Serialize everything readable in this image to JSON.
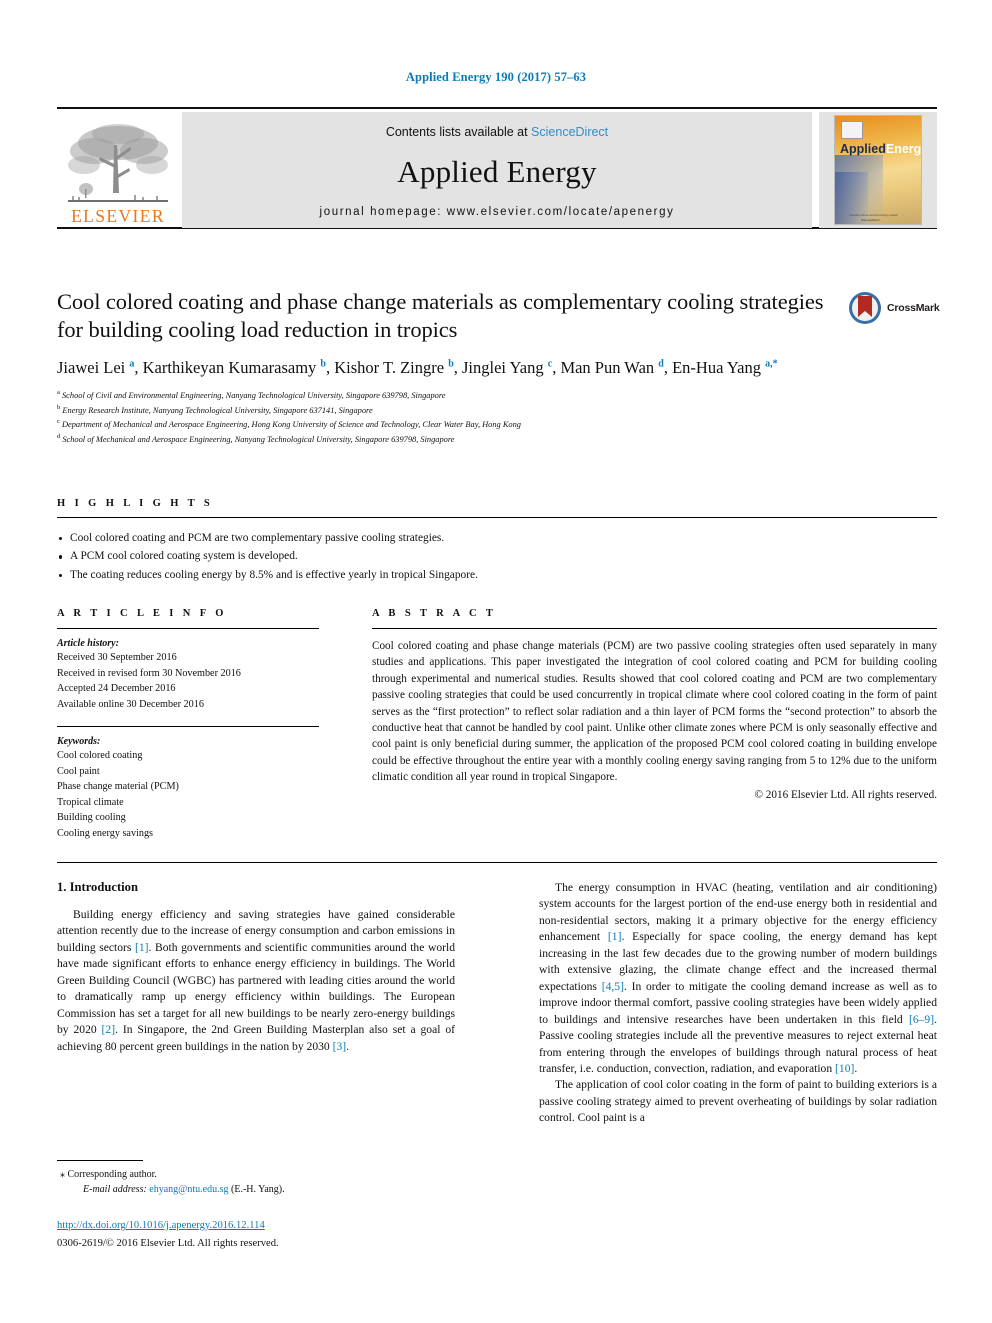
{
  "journal_ref": "Applied Energy 190 (2017) 57–63",
  "masthead": {
    "contents_prefix": "Contents lists available at ",
    "sciencedirect": "ScienceDirect",
    "journal_title": "Applied Energy",
    "homepage": "journal homepage: www.elsevier.com/locate/apenergy",
    "publisher_logo_word": "ELSEVIER",
    "cover": {
      "title_left": "Applied",
      "title_right": "Energy",
      "footer_small": "Constant-volume and time-varying models",
      "footer_small2": "ScienceDirect"
    }
  },
  "title": "Cool colored coating and phase change materials as complementary cooling strategies for building cooling load reduction in tropics",
  "crossmark_label": "CrossMark",
  "authors_html": "Jiawei Lei <sup>a</sup>, Karthikeyan Kumarasamy <sup>b</sup>, Kishor T. Zingre <sup>b</sup>, Jinglei Yang <sup>c</sup>, Man Pun Wan <sup>d</sup>, En-Hua Yang <sup>a,</sup><sup>*</sup>",
  "affiliations": [
    {
      "mark": "a",
      "text": "School of Civil and Environmental Engineering, Nanyang Technological University, Singapore 639798, Singapore"
    },
    {
      "mark": "b",
      "text": "Energy Research Institute, Nanyang Technological University, Singapore 637141, Singapore"
    },
    {
      "mark": "c",
      "text": "Department of Mechanical and Aerospace Engineering, Hong Kong University of Science and Technology, Clear Water Bay, Hong Kong"
    },
    {
      "mark": "d",
      "text": "School of Mechanical and Aerospace Engineering, Nanyang Technological University, Singapore 639798, Singapore"
    }
  ],
  "highlights": {
    "label": "H I G H L I G H T S",
    "items": [
      "Cool colored coating and PCM are two complementary passive cooling strategies.",
      "A PCM cool colored coating system is developed.",
      "The coating reduces cooling energy by 8.5% and is effective yearly in tropical Singapore."
    ]
  },
  "article_info": {
    "label": "A R T I C L E   I N F O",
    "history_label": "Article history:",
    "history": [
      "Received 30 September 2016",
      "Received in revised form 30 November 2016",
      "Accepted 24 December 2016",
      "Available online 30 December 2016"
    ],
    "keywords_label": "Keywords:",
    "keywords": [
      "Cool colored coating",
      "Cool paint",
      "Phase change material (PCM)",
      "Tropical climate",
      "Building cooling",
      "Cooling energy savings"
    ]
  },
  "abstract": {
    "label": "A B S T R A C T",
    "text": "Cool colored coating and phase change materials (PCM) are two passive cooling strategies often used separately in many studies and applications. This paper investigated the integration of cool colored coating and PCM for building cooling through experimental and numerical studies. Results showed that cool colored coating and PCM are two complementary passive cooling strategies that could be used concurrently in tropical climate where cool colored coating in the form of paint serves as the “first protection” to reflect solar radiation and a thin layer of PCM forms the “second protection” to absorb the conductive heat that cannot be handled by cool paint. Unlike other climate zones where PCM is only seasonally effective and cool paint is only beneficial during summer, the application of the proposed PCM cool colored coating in building envelope could be effective throughout the entire year with a monthly cooling energy saving ranging from 5 to 12% due to the uniform climatic condition all year round in tropical Singapore.",
    "copyright": "© 2016 Elsevier Ltd. All rights reserved."
  },
  "body": {
    "section_heading": "1. Introduction",
    "left_paragraphs": [
      "Building energy efficiency and saving strategies have gained considerable attention recently due to the increase of energy consumption and carbon emissions in building sectors [1]. Both governments and scientific communities around the world have made significant efforts to enhance energy efficiency in buildings. The World Green Building Council (WGBC) has partnered with leading cities around the world to dramatically ramp up energy efficiency within buildings. The European Commission has set a target for all new buildings to be nearly zero-energy buildings by 2020 [2]. In Singapore, the 2nd Green Building Masterplan also set a goal of achieving 80 percent green buildings in the nation by 2030 [3]."
    ],
    "right_paragraphs": [
      "The energy consumption in HVAC (heating, ventilation and air conditioning) system accounts for the largest portion of the end-use energy both in residential and non-residential sectors, making it a primary objective for the energy efficiency enhancement [1]. Especially for space cooling, the energy demand has kept increasing in the last few decades due to the growing number of modern buildings with extensive glazing, the climate change effect and the increased thermal expectations [4,5]. In order to mitigate the cooling demand increase as well as to improve indoor thermal comfort, passive cooling strategies have been widely applied to buildings and intensive researches have been undertaken in this field [6–9]. Passive cooling strategies include all the preventive measures to reject external heat from entering through the envelopes of buildings through natural process of heat transfer, i.e. conduction, convection, radiation, and evaporation [10].",
      "The application of cool color coating in the form of paint to building exteriors is a passive cooling strategy aimed to prevent overheating of buildings by solar radiation control. Cool paint is a"
    ]
  },
  "footnote": {
    "corresponding": "Corresponding author.",
    "email_label": "E-mail address:",
    "email": "ehyang@ntu.edu.sg",
    "email_owner": "(E.-H. Yang)."
  },
  "doi": "http://dx.doi.org/10.1016/j.apenergy.2016.12.114",
  "issn_line": "0306-2619/© 2016 Elsevier Ltd. All rights reserved.",
  "colors": {
    "link_blue": "#0b7bb5",
    "sciencedirect_blue": "#2f8fd0",
    "elsevier_orange": "#E8761A"
  }
}
